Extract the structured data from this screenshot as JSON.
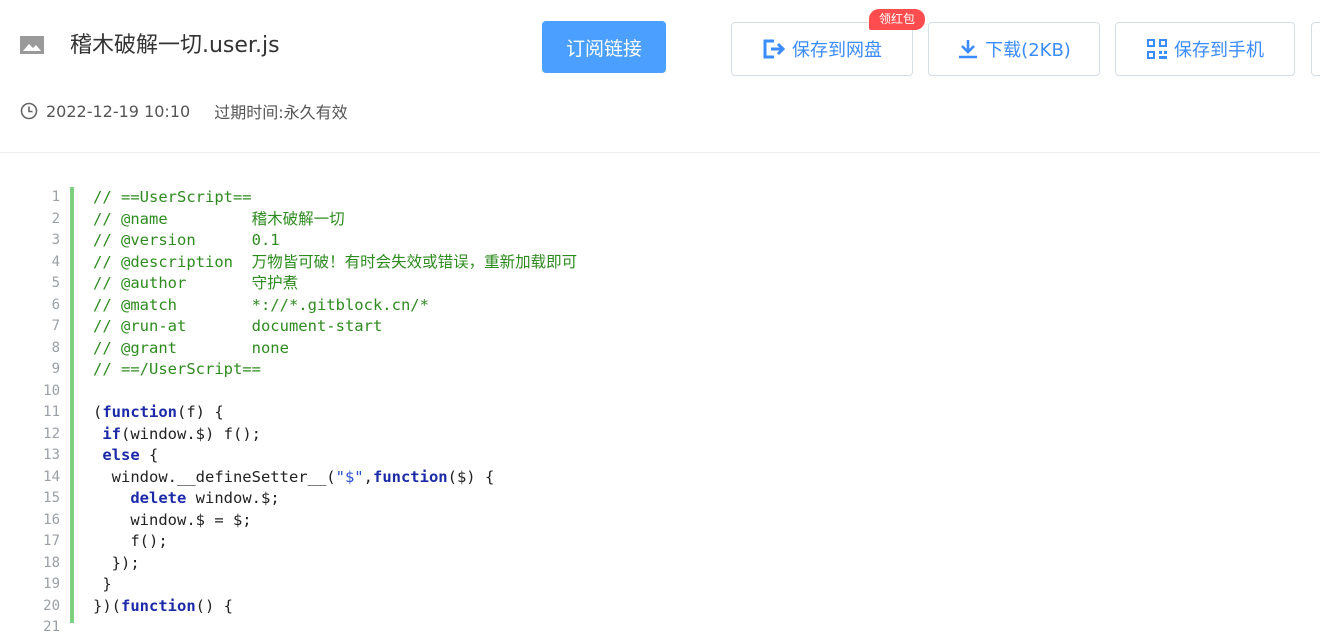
{
  "header": {
    "file_name": "稽木破解一切.user.js",
    "subscribe_label": "订阅链接",
    "promo_badge": "领红包",
    "buttons": {
      "save_to_disk": "保存到网盘",
      "download": "下载(2KB)",
      "save_to_phone": "保存到手机"
    },
    "timestamp": "2022-12-19 10:10",
    "expire_label": "过期时间:",
    "expire_value": "永久有效"
  },
  "colors": {
    "primary": "#4a9fff",
    "link": "#3b8cff",
    "badge": "#ff4d4f",
    "gutter_bar": "#7ed07e",
    "comment": "#2e8b1f",
    "keyword": "#1c2aa8",
    "string": "#2a4fd0"
  },
  "code": {
    "language": "javascript",
    "lines": [
      {
        "number": "1",
        "tokens": [
          {
            "type": "comment",
            "text": "// ==UserScript=="
          }
        ]
      },
      {
        "number": "2",
        "tokens": [
          {
            "type": "comment",
            "text": "// @name         稽木破解一切"
          }
        ]
      },
      {
        "number": "3",
        "tokens": [
          {
            "type": "comment",
            "text": "// @version      0.1"
          }
        ]
      },
      {
        "number": "4",
        "tokens": [
          {
            "type": "comment",
            "text": "// @description  万物皆可破！有时会失效或错误，重新加载即可"
          }
        ]
      },
      {
        "number": "5",
        "tokens": [
          {
            "type": "comment",
            "text": "// @author       守护煮"
          }
        ]
      },
      {
        "number": "6",
        "tokens": [
          {
            "type": "comment",
            "text": "// @match        *://*.gitblock.cn/*"
          }
        ]
      },
      {
        "number": "7",
        "tokens": [
          {
            "type": "comment",
            "text": "// @run-at       document-start"
          }
        ]
      },
      {
        "number": "8",
        "tokens": [
          {
            "type": "comment",
            "text": "// @grant        none"
          }
        ]
      },
      {
        "number": "9",
        "tokens": [
          {
            "type": "comment",
            "text": "// ==/UserScript=="
          }
        ]
      },
      {
        "number": "10",
        "tokens": []
      },
      {
        "number": "11",
        "tokens": [
          {
            "type": "plain",
            "text": "("
          },
          {
            "type": "keyword",
            "text": "function"
          },
          {
            "type": "plain",
            "text": "(f) {"
          }
        ]
      },
      {
        "number": "12",
        "tokens": [
          {
            "type": "plain",
            "text": " "
          },
          {
            "type": "keyword",
            "text": "if"
          },
          {
            "type": "plain",
            "text": "(window.$) f();"
          }
        ]
      },
      {
        "number": "13",
        "tokens": [
          {
            "type": "plain",
            "text": " "
          },
          {
            "type": "keyword",
            "text": "else"
          },
          {
            "type": "plain",
            "text": " {"
          }
        ]
      },
      {
        "number": "14",
        "tokens": [
          {
            "type": "plain",
            "text": "  window.__defineSetter__("
          },
          {
            "type": "string",
            "text": "\"$\""
          },
          {
            "type": "plain",
            "text": ","
          },
          {
            "type": "keyword",
            "text": "function"
          },
          {
            "type": "plain",
            "text": "($) {"
          }
        ]
      },
      {
        "number": "15",
        "tokens": [
          {
            "type": "plain",
            "text": "    "
          },
          {
            "type": "keyword",
            "text": "delete"
          },
          {
            "type": "plain",
            "text": " window.$;"
          }
        ]
      },
      {
        "number": "16",
        "tokens": [
          {
            "type": "plain",
            "text": "    window.$ = $;"
          }
        ]
      },
      {
        "number": "17",
        "tokens": [
          {
            "type": "plain",
            "text": "    f();"
          }
        ]
      },
      {
        "number": "18",
        "tokens": [
          {
            "type": "plain",
            "text": "  });"
          }
        ]
      },
      {
        "number": "19",
        "tokens": [
          {
            "type": "plain",
            "text": " }"
          }
        ]
      },
      {
        "number": "20",
        "tokens": [
          {
            "type": "plain",
            "text": "})("
          },
          {
            "type": "keyword",
            "text": "function"
          },
          {
            "type": "plain",
            "text": "() {"
          }
        ]
      },
      {
        "number": "21",
        "tokens": []
      }
    ]
  }
}
